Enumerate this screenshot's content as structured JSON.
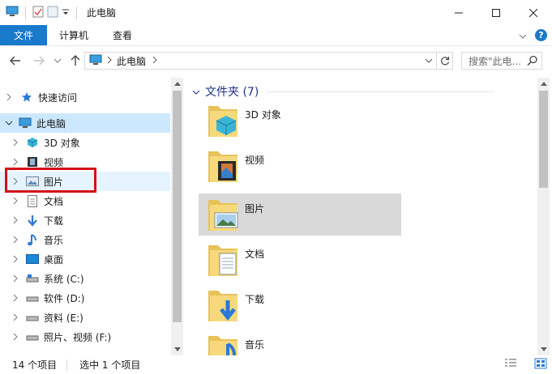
{
  "title": "此电脑",
  "ribbon": {
    "tabs": [
      "文件",
      "计算机",
      "查看"
    ]
  },
  "address": {
    "path": "此电脑"
  },
  "search": {
    "placeholder": "搜索\"此电..."
  },
  "nav": {
    "items": [
      {
        "label": "快速访问",
        "icon": "star-icon"
      },
      {
        "label": "此电脑",
        "icon": "computer-icon",
        "selected": true
      },
      {
        "label": "3D 对象",
        "icon": "3d-objects-icon"
      },
      {
        "label": "视频",
        "icon": "video-icon"
      },
      {
        "label": "图片",
        "icon": "pictures-icon"
      },
      {
        "label": "文档",
        "icon": "documents-icon"
      },
      {
        "label": "下载",
        "icon": "download-icon"
      },
      {
        "label": "音乐",
        "icon": "music-icon"
      },
      {
        "label": "桌面",
        "icon": "desktop-icon"
      },
      {
        "label": "系统 (C:)",
        "icon": "drive-icon"
      },
      {
        "label": "软件 (D:)",
        "icon": "drive-icon"
      },
      {
        "label": "资料 (E:)",
        "icon": "drive-icon"
      },
      {
        "label": "照片、视频 (F:)",
        "icon": "drive-icon"
      }
    ]
  },
  "content": {
    "group_title": "文件夹 (7)",
    "items": [
      {
        "label": "3D 对象",
        "icon": "3d-objects-folder-icon"
      },
      {
        "label": "视频",
        "icon": "video-folder-icon"
      },
      {
        "label": "图片",
        "icon": "pictures-folder-icon",
        "selected": true
      },
      {
        "label": "文档",
        "icon": "documents-folder-icon"
      },
      {
        "label": "下载",
        "icon": "download-folder-icon"
      },
      {
        "label": "音乐",
        "icon": "music-folder-icon"
      }
    ]
  },
  "status": {
    "count": "14 个项目",
    "selected": "选中 1 个项目"
  },
  "colors": {
    "accent": "#1979ca",
    "selection": "#cce8ff",
    "highlight_box": "#d40f18",
    "group_title": "#1e3287"
  }
}
